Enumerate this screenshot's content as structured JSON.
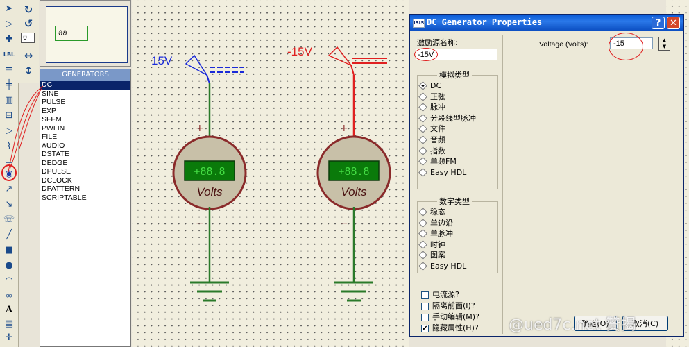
{
  "overview": {
    "mark_text": "ϑϑ"
  },
  "toolbar2": {
    "rotation_value": "0"
  },
  "generators": {
    "header": "GENERATORS",
    "items": [
      "DC",
      "SINE",
      "PULSE",
      "EXP",
      "SFFM",
      "PWLIN",
      "FILE",
      "AUDIO",
      "DSTATE",
      "DEDGE",
      "DPULSE",
      "DCLOCK",
      "DPATTERN",
      "SCRIPTABLE"
    ],
    "selected": "DC"
  },
  "schematic": {
    "left": {
      "label": "15V",
      "label_color": "#1a2ad8",
      "meter_display": "+88.8",
      "meter_unit": "Volts",
      "wire_color": "#2a7a2a"
    },
    "right": {
      "label": "-15V",
      "label_color": "#e02020",
      "meter_display": "+88.8",
      "meter_unit": "Volts",
      "wire_color": "#e02020"
    },
    "plus": "+",
    "minus": "−"
  },
  "dialog": {
    "title": "DC Generator Properties",
    "icon_text": "ISIS",
    "help_label": "?",
    "close_label": "✕",
    "name_label": "激励源名称:",
    "name_value": "-15V",
    "analog_legend": "模拟类型",
    "analog_options": [
      "DC",
      "正弦",
      "脉冲",
      "分段线型脉冲",
      "文件",
      "音频",
      "指数",
      "单频FM",
      "Easy HDL"
    ],
    "analog_selected": "DC",
    "digital_legend": "数字类型",
    "digital_options": [
      "稳态",
      "单边沿",
      "单脉冲",
      "时钟",
      "图案",
      "Easy HDL"
    ],
    "checkboxes": [
      {
        "label": "电流源?",
        "checked": false
      },
      {
        "label": "隔离前面(I)?",
        "checked": false
      },
      {
        "label": "手动编辑(M)?",
        "checked": false
      },
      {
        "label": "隐藏属性(H)?",
        "checked": true
      }
    ],
    "voltage_label": "Voltage (Volts):",
    "voltage_value": "-15",
    "ok_label": "确定(O)",
    "cancel_label": "取消(C)",
    "watermark": "@ued7c.net 赞揭"
  }
}
